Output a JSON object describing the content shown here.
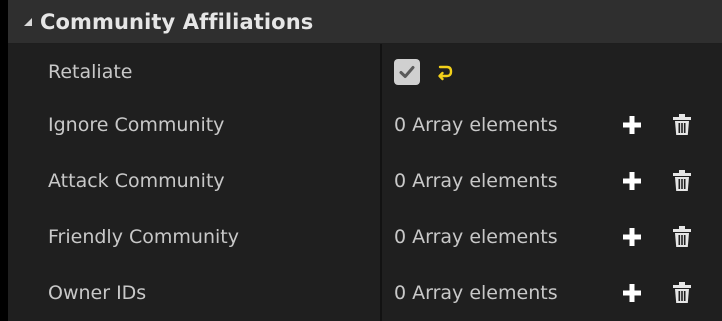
{
  "section": {
    "title": "Community Affiliations",
    "expanded": true
  },
  "properties": [
    {
      "name": "Retaliate",
      "type": "checkbox",
      "checked": true
    },
    {
      "name": "Ignore Community",
      "type": "array",
      "value": "0 Array elements"
    },
    {
      "name": "Attack Community",
      "type": "array",
      "value": "0 Array elements"
    },
    {
      "name": "Friendly Community",
      "type": "array",
      "value": "0 Array elements"
    },
    {
      "name": "Owner IDs",
      "type": "array",
      "value": "0 Array elements"
    }
  ],
  "icons": {
    "collapse": "collapse-arrow-icon",
    "check": "checkmark-icon",
    "reset": "reset-to-default-icon",
    "add": "plus-icon",
    "remove": "trash-icon"
  },
  "colors": {
    "background": "#1f1f1f",
    "header": "#2f2f2f",
    "text": "#c8c8c8",
    "reset_accent": "#f2d01a"
  }
}
